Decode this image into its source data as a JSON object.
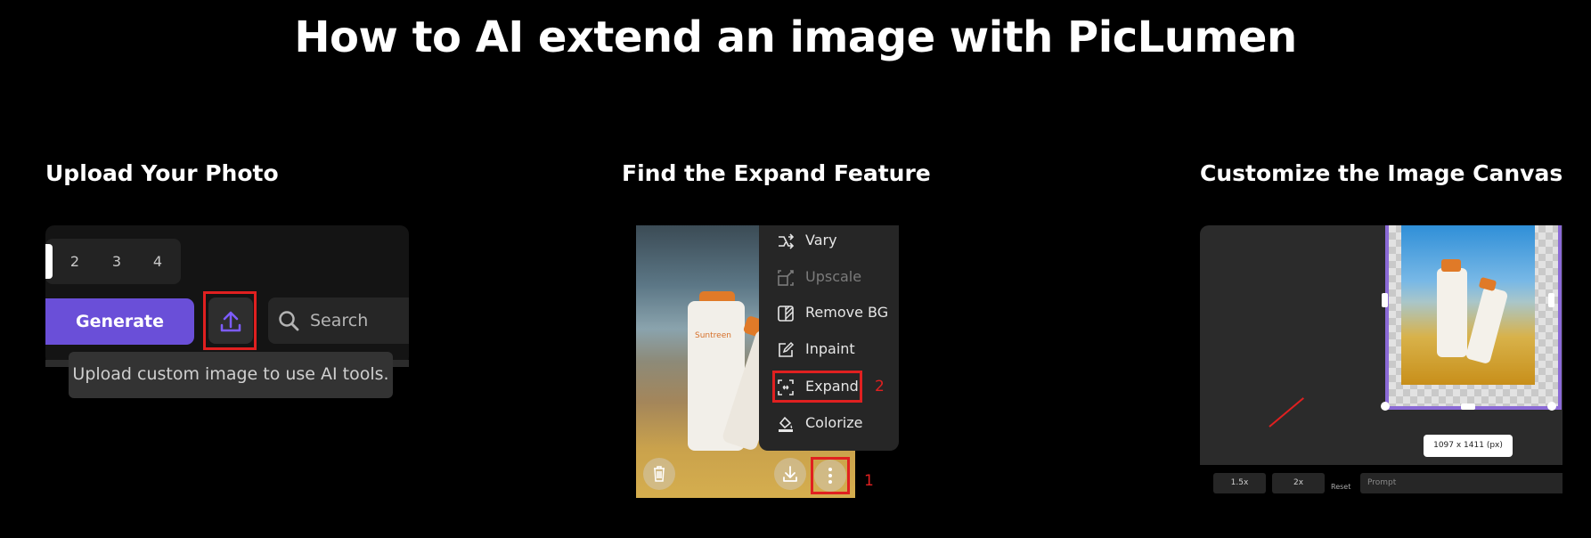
{
  "title": "How to AI extend an image with PicLumen",
  "steps": [
    {
      "title": "Upload Your Photo"
    },
    {
      "title": "Find the Expand Feature"
    },
    {
      "title": "Customize the Image Canvas"
    }
  ],
  "upload_panel": {
    "tabs": [
      "2",
      "3",
      "4"
    ],
    "generate_label": "Generate",
    "search_placeholder": "Search",
    "tooltip": "Upload custom image to use AI tools."
  },
  "expand_panel": {
    "menu_items": [
      {
        "label": "Vary",
        "icon": "vary-icon",
        "disabled": false
      },
      {
        "label": "Upscale",
        "icon": "upscale-icon",
        "disabled": true
      },
      {
        "label": "Remove BG",
        "icon": "remove-bg-icon",
        "disabled": false
      },
      {
        "label": "Inpaint",
        "icon": "inpaint-icon",
        "disabled": false
      },
      {
        "label": "Expand",
        "icon": "expand-icon",
        "disabled": false
      },
      {
        "label": "Colorize",
        "icon": "colorize-icon",
        "disabled": false
      }
    ],
    "step_markers": [
      "2",
      "1"
    ],
    "bottle_text": "Suntreen"
  },
  "canvas_panel": {
    "size_label": "1097 x 1411 (px)",
    "ratio_buttons": [
      "1.5x",
      "2x"
    ],
    "reset_label": "Reset",
    "prompt_placeholder": "Prompt"
  },
  "colors": {
    "accent": "#6a4fd8",
    "highlight": "#e02020",
    "canvas_border": "#8b6ad6"
  }
}
